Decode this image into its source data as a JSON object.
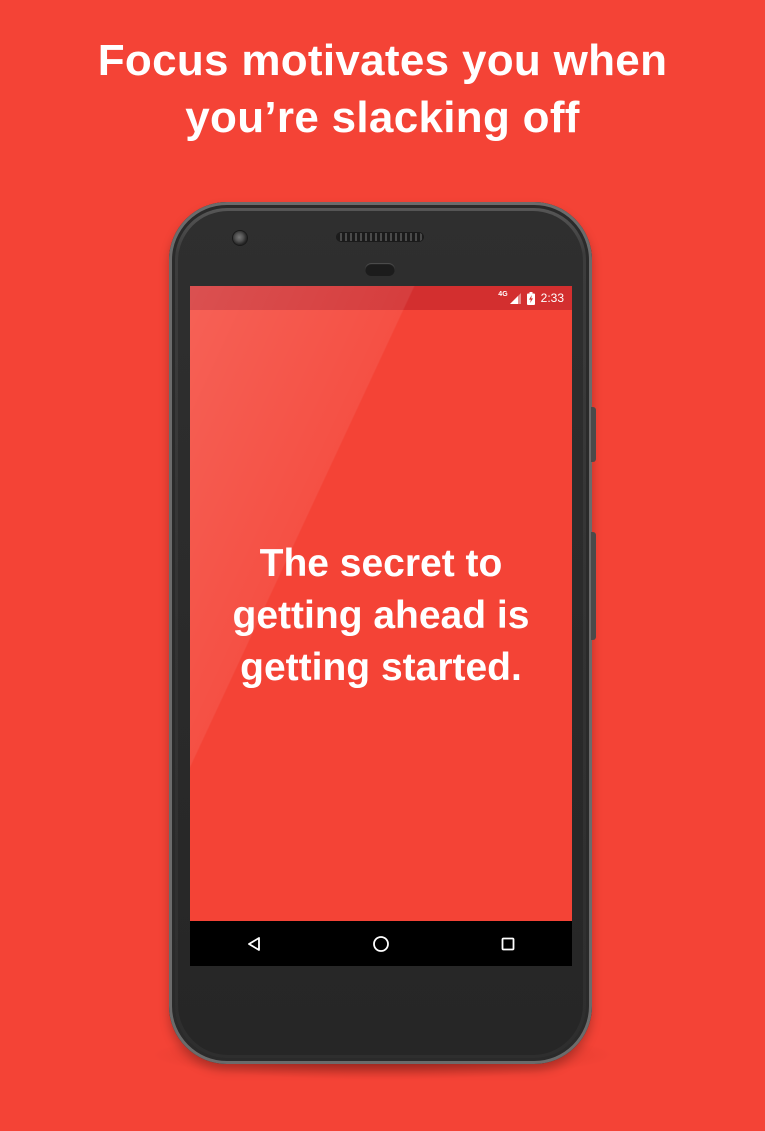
{
  "headline": {
    "line1": "Focus motivates you when",
    "line2": "you’re slacking off"
  },
  "status_bar": {
    "network": "4G",
    "time": "2:33",
    "icons": [
      "signal-icon",
      "battery-charging-icon"
    ]
  },
  "screen": {
    "quote_line1": "The secret to",
    "quote_line2": "getting ahead is",
    "quote_line3": "getting started."
  },
  "nav_bar": {
    "icons": [
      "back-icon",
      "home-icon",
      "recents-icon"
    ]
  },
  "colors": {
    "background": "#F44336",
    "status_bar": "#D32F2F",
    "nav_bar": "#000000",
    "text": "#FFFFFF"
  }
}
